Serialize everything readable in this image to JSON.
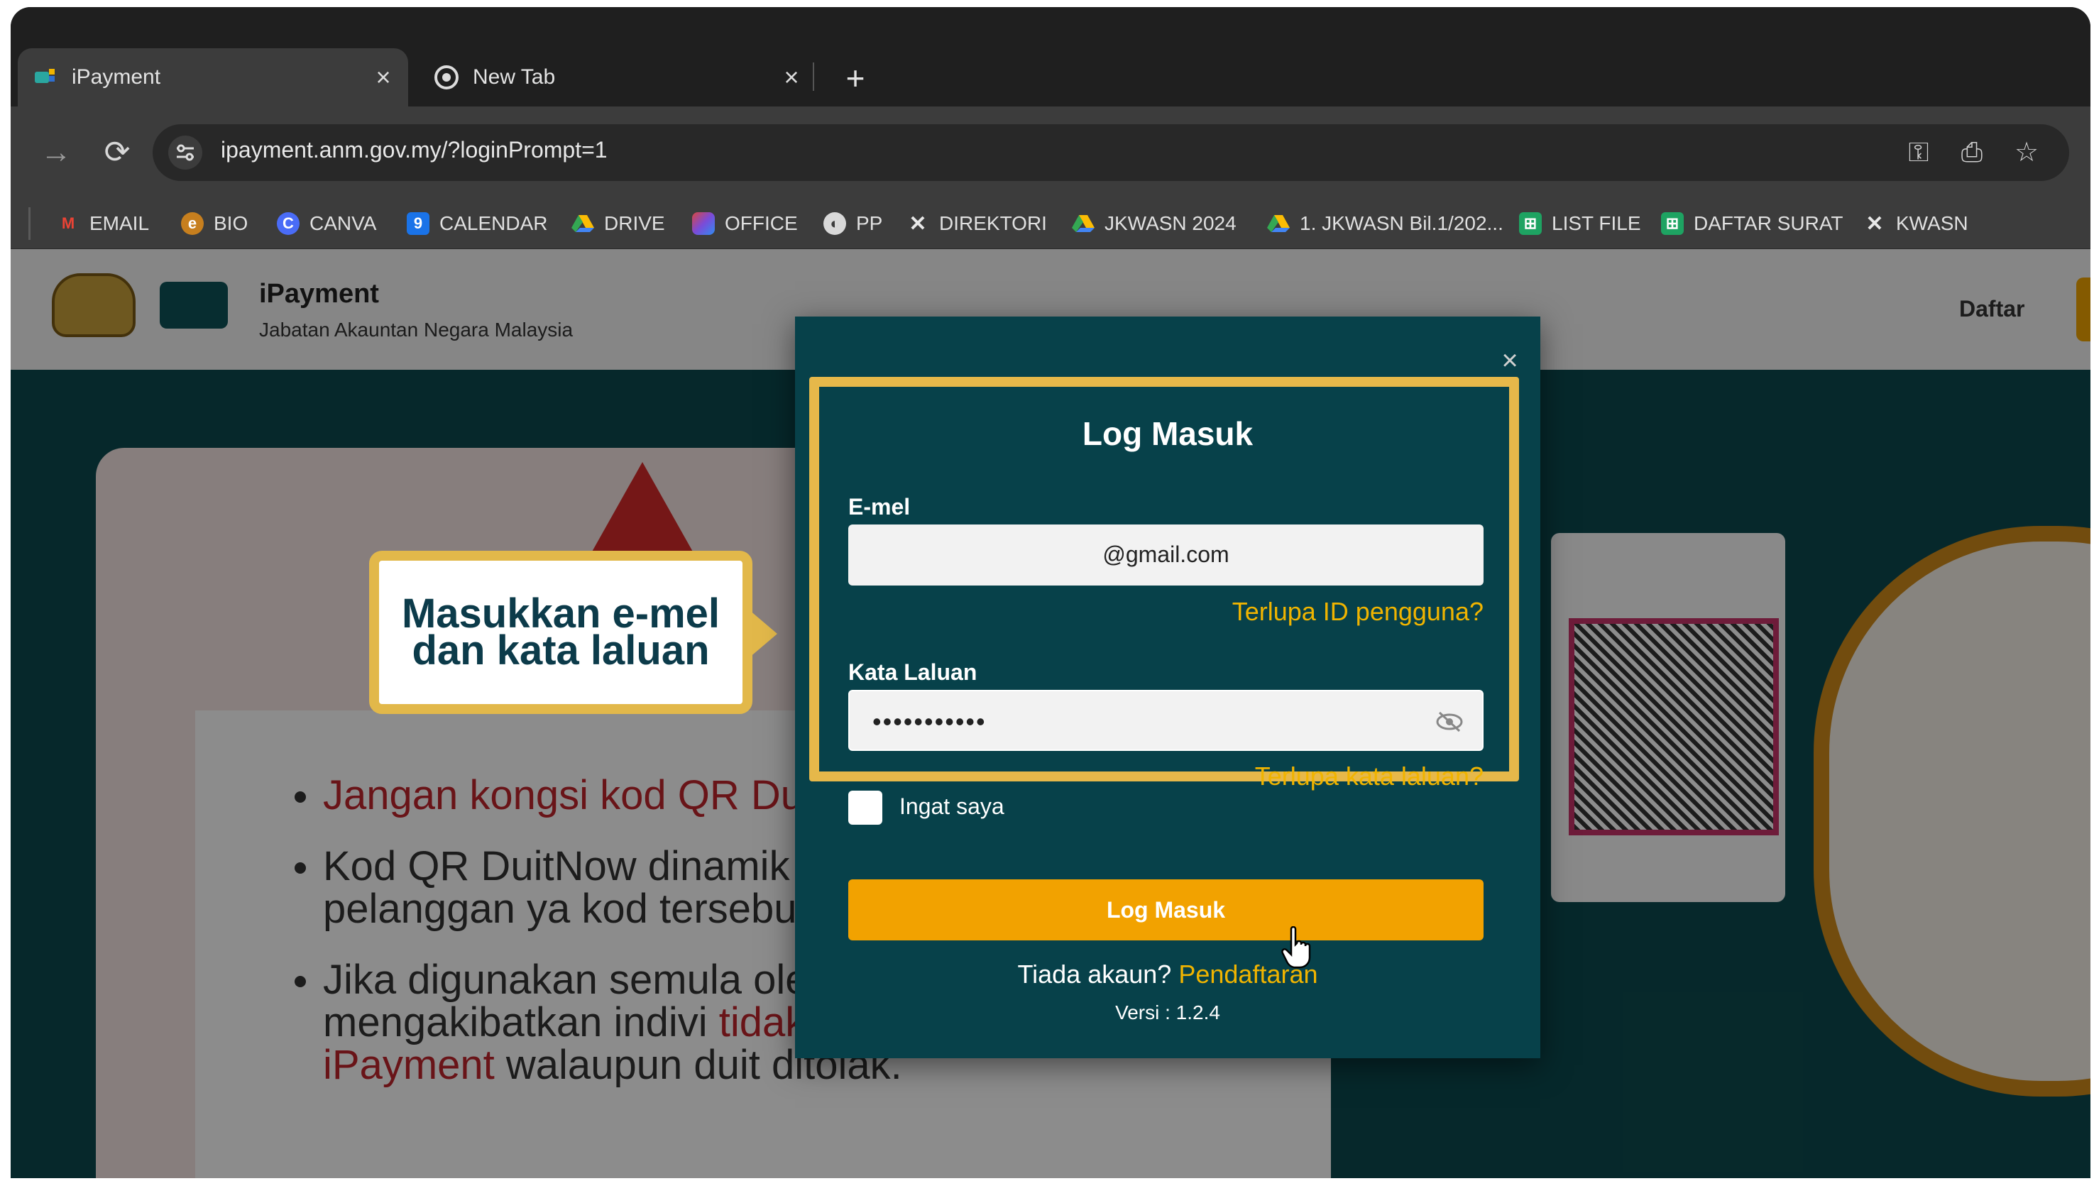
{
  "browser": {
    "tabs": [
      {
        "title": "iPayment",
        "active": true,
        "icon": "ipayment-favicon"
      },
      {
        "title": "New Tab",
        "active": false,
        "icon": "chrome-icon"
      }
    ],
    "url": "ipayment.anm.gov.my/?loginPrompt=1",
    "bookmarks": [
      {
        "label": "EMAIL",
        "icon": "gmail-icon"
      },
      {
        "label": "BIO",
        "icon": "bio-icon"
      },
      {
        "label": "CANVA",
        "icon": "canva-icon"
      },
      {
        "label": "CALENDAR",
        "icon": "calendar-icon"
      },
      {
        "label": "DRIVE",
        "icon": "drive-icon"
      },
      {
        "label": "OFFICE",
        "icon": "office-icon"
      },
      {
        "label": "PP",
        "icon": "globe-icon"
      },
      {
        "label": "DIREKTORI",
        "icon": "joomla-icon"
      },
      {
        "label": "JKWASN 2024",
        "icon": "drive-icon"
      },
      {
        "label": "1. JKWASN Bil.1/202...",
        "icon": "drive-icon"
      },
      {
        "label": "LIST FILE",
        "icon": "sheets-icon"
      },
      {
        "label": "DAFTAR SURAT",
        "icon": "sheets-icon"
      },
      {
        "label": "KWASN",
        "icon": "joomla-icon"
      }
    ]
  },
  "site": {
    "brand": "iPayment",
    "department": "Jabatan Akauntan Negara Malaysia",
    "register_link": "Daftar"
  },
  "background_banner": {
    "bullet1": "Jangan kongsi kod QR DuitN",
    "bullet2": "Kod QR DuitNow dinamik pe terus di portal pelanggan ya kod tersebut.",
    "bullet3_a": "Jika digunakan semula oleh boleh mengakibatkan indivi",
    "bullet3_red": "tidak menerima resit iPayment",
    "bullet3_b": "walaupun duit ditolak."
  },
  "callout": {
    "line1": "Masukkan e-mel",
    "line2": "dan kata laluan"
  },
  "login": {
    "title": "Log Masuk",
    "email_label": "E-mel",
    "email_value": "@gmail.com",
    "forgot_id": "Terlupa ID pengguna?",
    "password_label": "Kata Laluan",
    "password_value": "•••••••••••",
    "forgot_password": "Terlupa kata laluan?",
    "remember_me": "Ingat saya",
    "submit": "Log Masuk",
    "no_account": "Tiada akaun?",
    "register": "Pendaftaran",
    "version": "Versi : 1.2.4"
  },
  "colors": {
    "modal_bg": "#07414a",
    "accent": "#f2a200",
    "highlight_border": "#e6b84a"
  }
}
